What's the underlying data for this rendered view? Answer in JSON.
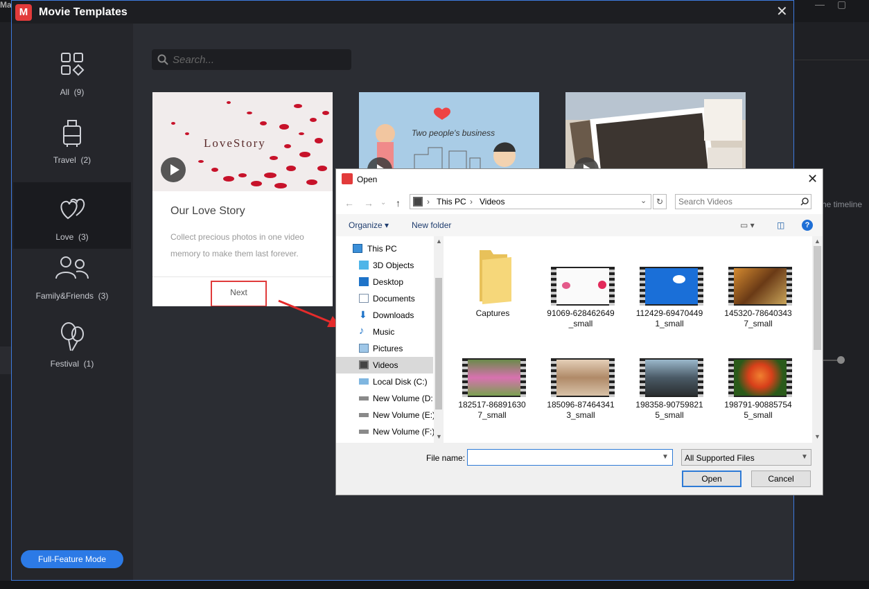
{
  "background": {
    "app_title_fragment": "Ma",
    "right_panel_text": "he timeline"
  },
  "main_dialog": {
    "title": "Movie Templates",
    "close_icon": "close-icon",
    "categories": [
      {
        "label": "All",
        "count": "(9)",
        "icon": "grid-icon"
      },
      {
        "label": "Travel",
        "count": "(2)",
        "icon": "luggage-icon"
      },
      {
        "label": "Love",
        "count": "(3)",
        "icon": "hearts-icon",
        "selected": true
      },
      {
        "label": "Family&Friends",
        "count": "(3)",
        "icon": "people-icon"
      },
      {
        "label": "Festival",
        "count": "(1)",
        "icon": "balloons-icon"
      }
    ],
    "full_feature_button": "Full-Feature Mode",
    "search_placeholder": "Search...",
    "cards": [
      {
        "thumb_text": "LoveStory",
        "title": "Our Love Story",
        "description": "Collect precious photos in one video memory to make them last forever.",
        "next_label": "Next"
      },
      {
        "thumb_text": "Two people's business"
      },
      {
        "thumb_text": ""
      }
    ]
  },
  "open_dialog": {
    "title": "Open",
    "breadcrumbs": [
      "This PC",
      "Videos"
    ],
    "search_placeholder": "Search Videos",
    "organize_label": "Organize",
    "new_folder_label": "New folder",
    "help_label": "?",
    "nav_items": [
      {
        "label": "This PC",
        "icon": "computer-icon"
      },
      {
        "label": "3D Objects",
        "icon": "cube-icon"
      },
      {
        "label": "Desktop",
        "icon": "desktop-icon"
      },
      {
        "label": "Documents",
        "icon": "document-icon"
      },
      {
        "label": "Downloads",
        "icon": "download-icon"
      },
      {
        "label": "Music",
        "icon": "music-icon"
      },
      {
        "label": "Pictures",
        "icon": "pictures-icon"
      },
      {
        "label": "Videos",
        "icon": "video-icon",
        "selected": true
      },
      {
        "label": "Local Disk (C:)",
        "icon": "drive-icon"
      },
      {
        "label": "New Volume (D:",
        "icon": "drive-icon"
      },
      {
        "label": "New Volume (E:)",
        "icon": "drive-icon"
      },
      {
        "label": "New Volume (F:)",
        "icon": "drive-icon"
      }
    ],
    "files": [
      {
        "name": "Captures",
        "type": "folder"
      },
      {
        "name": "91069-628462649_small",
        "line1": "91069-628462649",
        "line2": "_small",
        "type": "video",
        "color": "#ffffff"
      },
      {
        "name": "112429-694704491_small",
        "line1": "112429-69470449",
        "line2": "1_small",
        "type": "video",
        "color": "#1a6fd8"
      },
      {
        "name": "145320-786403437_small",
        "line1": "145320-78640343",
        "line2": "7_small",
        "type": "video",
        "color": "#b57a2e"
      },
      {
        "name": "182517-868916307_small",
        "line1": "182517-86891630",
        "line2": "7_small",
        "type": "video",
        "color": "#c85a9a"
      },
      {
        "name": "185096-874643413_small",
        "line1": "185096-87464341",
        "line2": "3_small",
        "type": "video",
        "color": "#c9a788"
      },
      {
        "name": "198358-907598215_small",
        "line1": "198358-90759821",
        "line2": "5_small",
        "type": "video",
        "color": "#5d7588"
      },
      {
        "name": "198791-908857545_small",
        "line1": "198791-90885754",
        "line2": "5_small",
        "type": "video",
        "color": "#e0602a"
      }
    ],
    "file_name_label": "File name:",
    "file_name_value": "",
    "file_type_value": "All Supported Files",
    "open_button": "Open",
    "cancel_button": "Cancel"
  },
  "colors": {
    "accent": "#2c7ae6",
    "highlight_red": "#e03a3a",
    "dialog_bg": "#2b2d33"
  }
}
